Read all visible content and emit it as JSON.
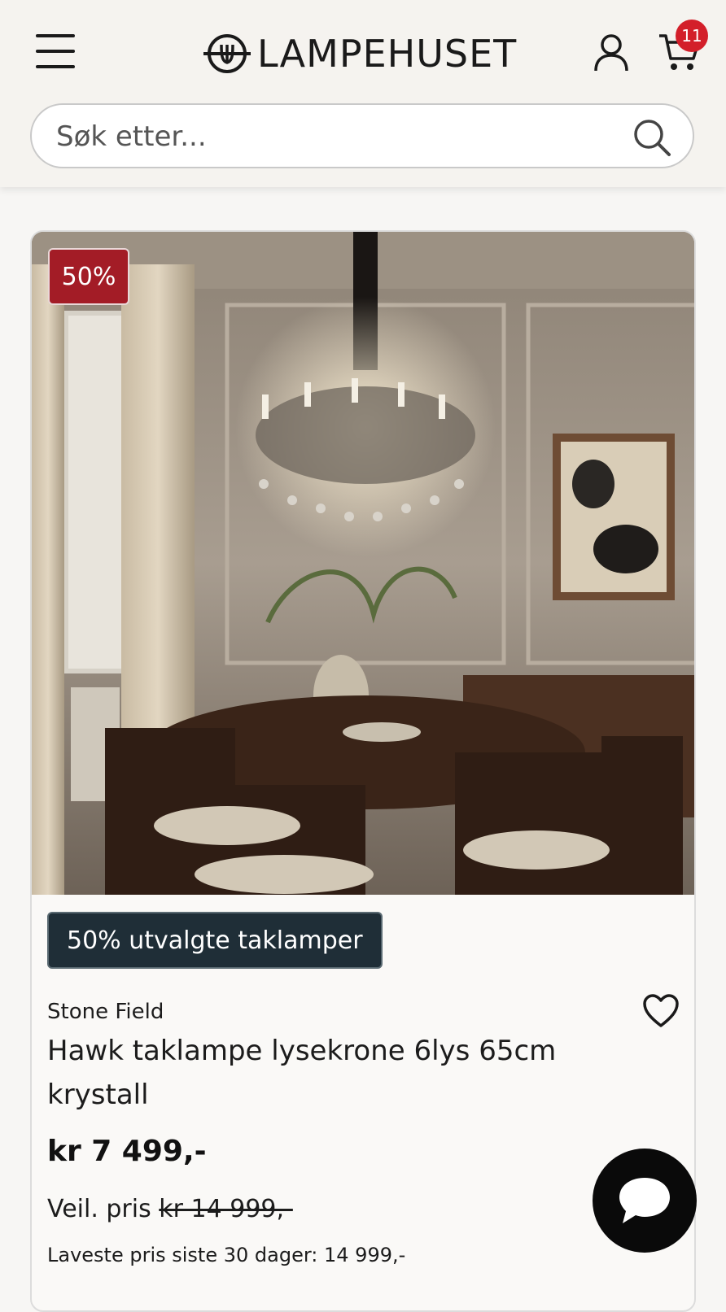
{
  "header": {
    "logo_text": "LAMPEHUSET",
    "cart_count": "11"
  },
  "search": {
    "placeholder": "Søk etter..."
  },
  "product": {
    "discount_badge": "50%",
    "promo_tag": "50% utvalgte taklamper",
    "brand": "Stone Field",
    "title": "Hawk taklampe lysekrone 6lys 65cm krystall",
    "price": "kr 7 499,-",
    "rrp_label": "Veil. pris",
    "rrp_value": "kr 14 999,-",
    "lowest_price": "Laveste pris siste 30 dager: 14 999,-"
  },
  "colors": {
    "badge_red": "#a31c26",
    "cart_badge": "#d31f2a",
    "promo_bg": "#1f2e37"
  },
  "icons": [
    "menu-icon",
    "logo-bulb-icon",
    "account-icon",
    "cart-icon",
    "search-icon",
    "heart-icon",
    "chat-icon"
  ]
}
